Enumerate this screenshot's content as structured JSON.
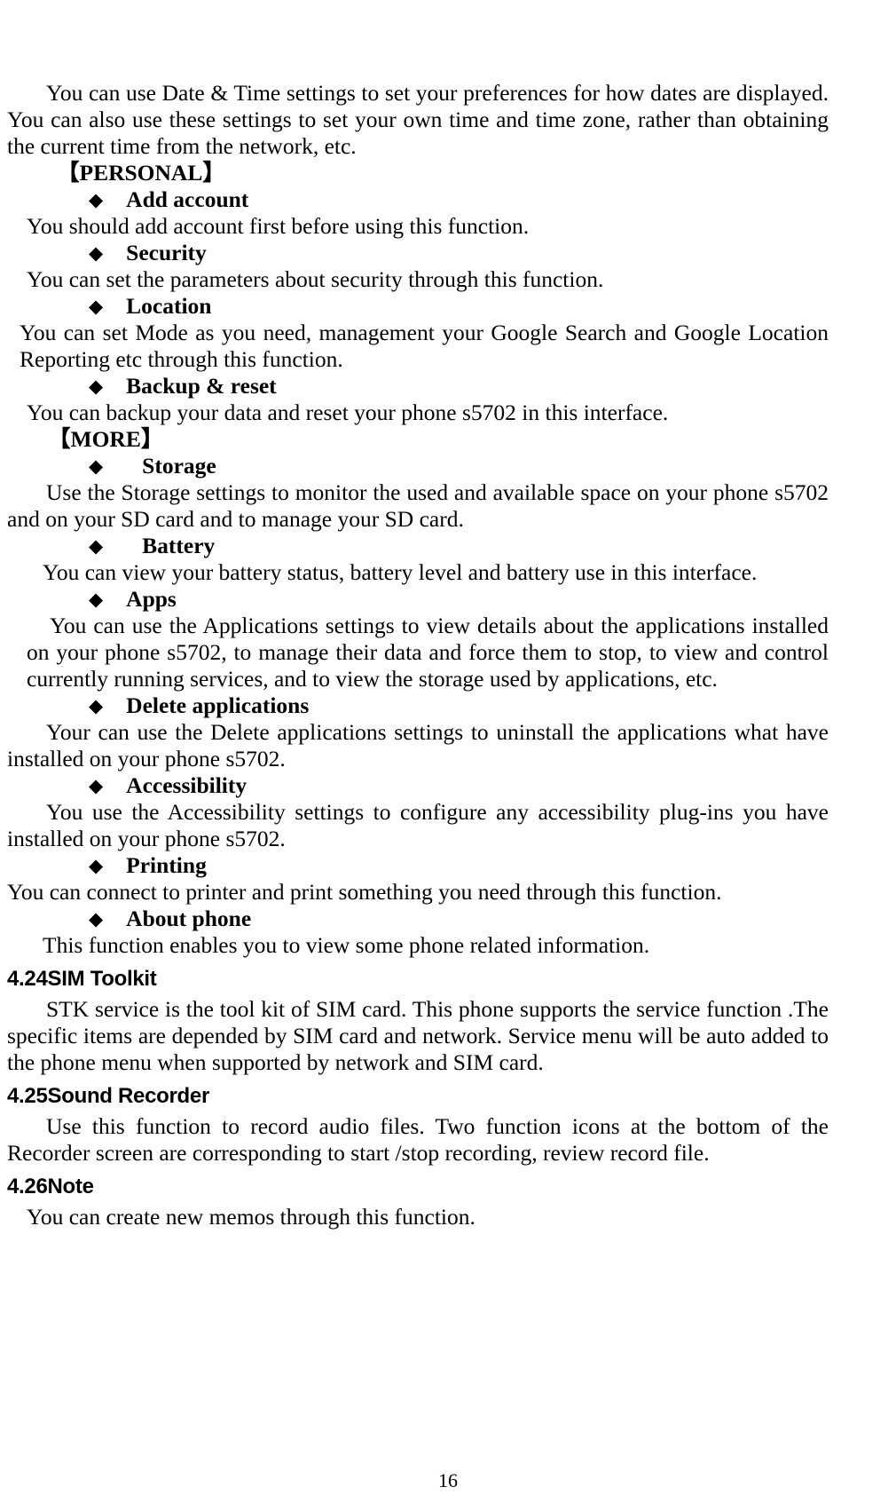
{
  "document": {
    "page_number": "16",
    "bullet_glyph": "◆"
  },
  "blocks": {
    "intro_paragraph": "You can use Date & Time settings to set your preferences for how dates are displayed. You can also use these settings to set your own time and time zone, rather than obtaining the current time from the network, etc.",
    "personal_group_label": "【PERSONAL】",
    "more_group_label": "【MORE】",
    "add_account_label": "Add account",
    "add_account_text": "You should add account first before using this function.",
    "security_label": "Security",
    "security_text": "You can set the parameters about security through this function.",
    "location_label": "Location",
    "location_text": "You can set Mode as you need, management your Google Search and Google Location Reporting etc through this function.",
    "backup_reset_label": "Backup & reset",
    "backup_reset_text": "You can backup your data and reset your phone s5702 in this interface.",
    "storage_label": "Storage",
    "storage_text": "Use the Storage settings to monitor the used and available space on your phone s5702 and on your SD card and to manage your SD card.",
    "battery_label": "Battery",
    "battery_text": "You can view your battery status, battery level and battery use in this interface.",
    "apps_label": "Apps",
    "apps_text": "You can use the Applications settings to view details about the applications installed on your phone s5702, to manage their data and force them to stop, to view and control currently running services, and to view the storage used by applications, etc.",
    "delete_applications_label": "Delete applications",
    "delete_applications_text": "Your can use the Delete applications settings to uninstall the applications what have installed on your phone s5702.",
    "accessibility_label": "Accessibility",
    "accessibility_text": "You use the Accessibility settings to configure any accessibility plug-ins you have installed on your phone s5702.",
    "printing_label": "Printing",
    "printing_text": "You can connect to printer and print something you need through this function.",
    "about_phone_label": "About phone",
    "about_phone_text": "This function enables you to view some phone related information.",
    "sim_toolkit_heading": "4.24SIM Toolkit",
    "sim_toolkit_text": "STK service is the tool kit of SIM card. This phone supports the service function .The specific items are depended by SIM card and network. Service menu will be auto added to the phone menu when supported by network and SIM card.",
    "sound_recorder_heading": "4.25Sound Recorder",
    "sound_recorder_text": "Use this function to record audio files. Two function icons at the bottom of the Recorder screen are corresponding to start /stop recording, review record file.",
    "note_heading": "4.26Note",
    "note_text": "You can create new memos through this function."
  }
}
